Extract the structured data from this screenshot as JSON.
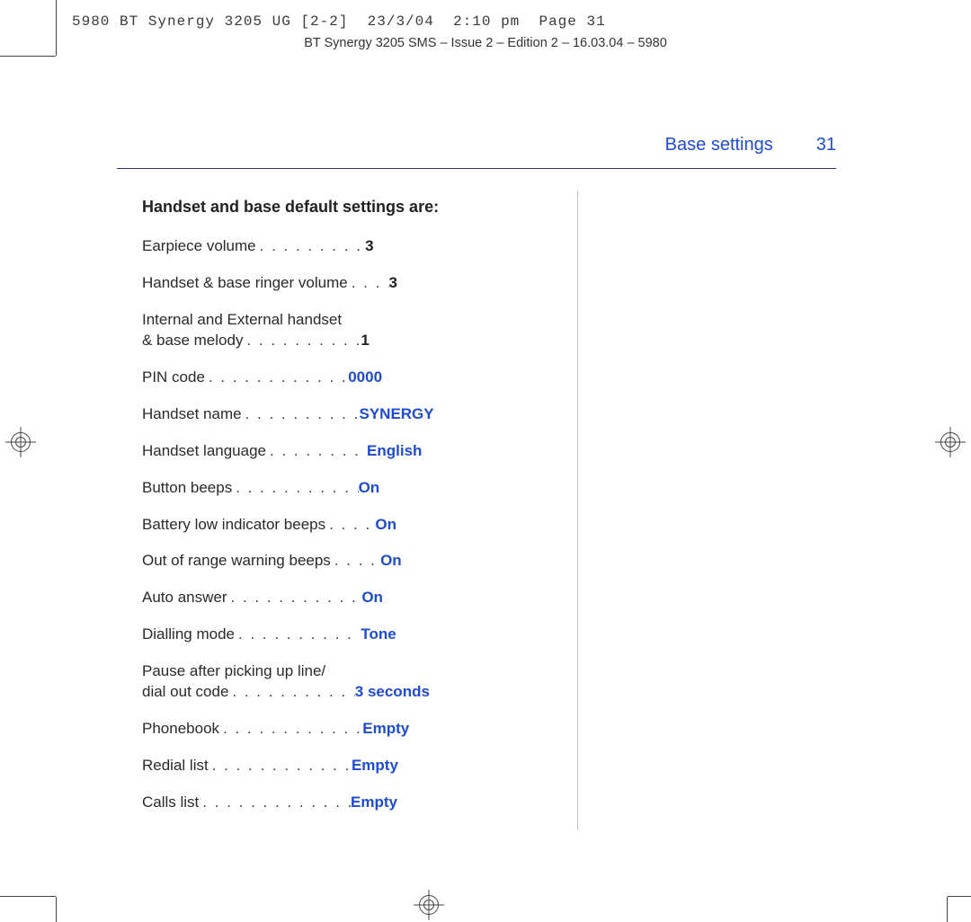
{
  "slug_line": "5980 BT Synergy 3205 UG [2-2]  23/3/04  2:10 pm  Page 31",
  "running_head": "BT Synergy 3205 SMS – Issue 2 – Edition 2 – 16.03.04 – 5980",
  "section_title": "Base settings",
  "page_number": "31",
  "heading": "Handset and base default settings are:",
  "dot_fill": ". . . . . . . . . . . . . . . . . . . . . . . . . . . . . . . . . . . . . . . .",
  "settings": [
    {
      "label": "Earpiece volume",
      "value": "3",
      "blue": false,
      "wrap_before": null,
      "dots_ch": 12
    },
    {
      "label": "Handset & base ringer volume",
      "value": "3",
      "blue": false,
      "wrap_before": null,
      "dots_ch": 4
    },
    {
      "label": "& base melody",
      "value": "1",
      "blue": false,
      "wrap_before": "Internal and External handset",
      "dots_ch": 13
    },
    {
      "label": "PIN code",
      "value": "0000",
      "blue": true,
      "wrap_before": null,
      "dots_ch": 16
    },
    {
      "label": "Handset name",
      "value": "SYNERGY",
      "blue": true,
      "wrap_before": null,
      "dots_ch": 13
    },
    {
      "label": "Handset language",
      "value": "English",
      "blue": true,
      "wrap_before": null,
      "dots_ch": 11
    },
    {
      "label": "Button beeps",
      "value": "On",
      "blue": true,
      "wrap_before": null,
      "dots_ch": 14
    },
    {
      "label": "Battery low indicator beeps",
      "value": "On",
      "blue": true,
      "wrap_before": null,
      "dots_ch": 5
    },
    {
      "label": "Out of range warning beeps",
      "value": "On",
      "blue": true,
      "wrap_before": null,
      "dots_ch": 5
    },
    {
      "label": "Auto answer",
      "value": "On",
      "blue": true,
      "wrap_before": null,
      "dots_ch": 15
    },
    {
      "label": "Dialling mode",
      "value": "Tone",
      "blue": true,
      "wrap_before": null,
      "dots_ch": 14
    },
    {
      "label": "dial out code",
      "value": "3 seconds",
      "blue": true,
      "wrap_before": "Pause after picking up line/",
      "dots_ch": 14
    },
    {
      "label": "Phonebook",
      "value": "Empty",
      "blue": true,
      "wrap_before": null,
      "dots_ch": 16
    },
    {
      "label": "Redial list",
      "value": "Empty",
      "blue": true,
      "wrap_before": null,
      "dots_ch": 16
    },
    {
      "label": "Calls list",
      "value": "Empty",
      "blue": true,
      "wrap_before": null,
      "dots_ch": 17
    }
  ]
}
